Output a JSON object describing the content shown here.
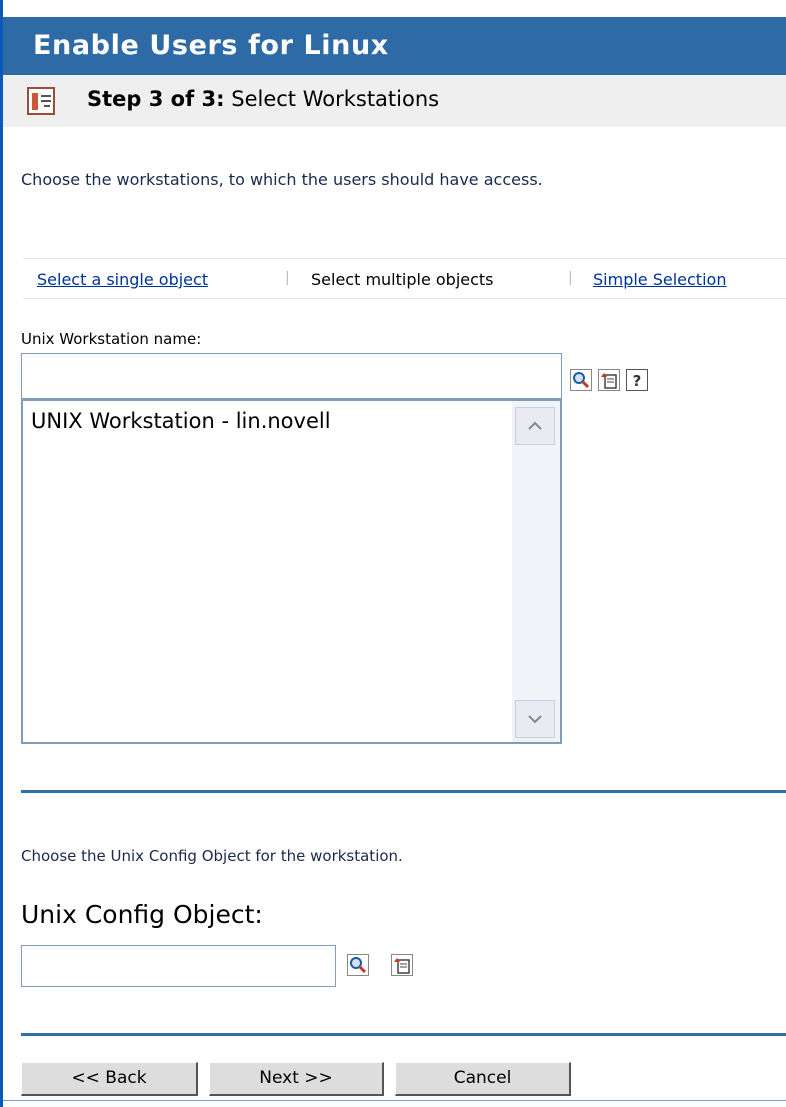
{
  "header": {
    "title": "Enable Users for Linux"
  },
  "step": {
    "prefix": "Step 3 of 3:",
    "title": "Select Workstations"
  },
  "instructions": {
    "workstations": "Choose the workstations, to which the users should have access.",
    "config": "Choose the Unix Config Object for the workstation."
  },
  "selection_tabs": [
    {
      "label": "Select a single object",
      "link": true
    },
    {
      "label": "Select multiple objects",
      "link": false
    },
    {
      "label": "Simple Selection",
      "link": true
    }
  ],
  "workstation_field": {
    "label": "Unix Workstation name:",
    "value": "",
    "list_items": [
      "UNIX Workstation - lin.novell"
    ]
  },
  "config_field": {
    "label": "Unix Config Object:",
    "value": ""
  },
  "buttons": {
    "back": "<< Back",
    "next": "Next >>",
    "cancel": "Cancel"
  },
  "icons": {
    "step": "wizard-step-icon",
    "search": "magnifier-icon",
    "browse": "object-browser-icon",
    "help": "help-icon"
  },
  "colors": {
    "title_bar": "#2e6aa6",
    "link": "#003399",
    "divider": "#3070a8"
  }
}
